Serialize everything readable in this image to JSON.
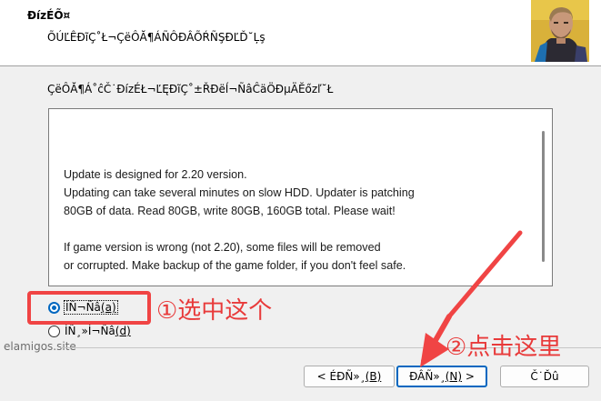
{
  "header": {
    "title": "ĐízÉÕ¤",
    "subtitle": "ÕÚĽÊĐĩÇ˚Ł¬ÇëÔĂ¶ÁÑÔĐÂÕŔÑŞĐĽĎ˘Ļş",
    "image_icon": "character-portrait"
  },
  "instruction": "ÇëÔĂ¶Á˚ĉČ˙ĐízÉŁ¬ĽĘĐĩÇ˚±ŘĐëĺ¬ÑâĈäÖĐµÄĔőzľ˘Ł",
  "license": {
    "lines": [
      "Update is designed for 2.20 version.",
      "Updating can take several minutes on slow HDD. Updater is patching",
      "80GB of data. Read 80GB, write 80GB, 160GB total. Please wait!",
      "",
      "If game version is wrong (not 2.20), some files will be removed",
      "or corrupted. Make backup of the game folder, if you don't feel safe."
    ]
  },
  "options": {
    "accept": {
      "text": "ÍÑ¬Ñâ",
      "mnemonic": "(a)",
      "checked": true
    },
    "decline": {
      "text": "ÍÑ¸»Í¬Ñâ",
      "mnemonic": "(d)",
      "checked": false
    }
  },
  "annotations": {
    "step1": "①选中这个",
    "step2": "②点击这里",
    "color": "#f04444"
  },
  "watermark": "elamigos.site",
  "buttons": {
    "back": {
      "text": "< ÉĐÑ»¸",
      "mnemonic": "(B)"
    },
    "next": {
      "text": "ĐÂÑ»¸",
      "mnemonic": "(N)",
      "suffix": " >"
    },
    "cancel": {
      "text": "Č˙Ďû"
    }
  },
  "colors": {
    "accent": "#0067c0",
    "annotation": "#f04444"
  }
}
